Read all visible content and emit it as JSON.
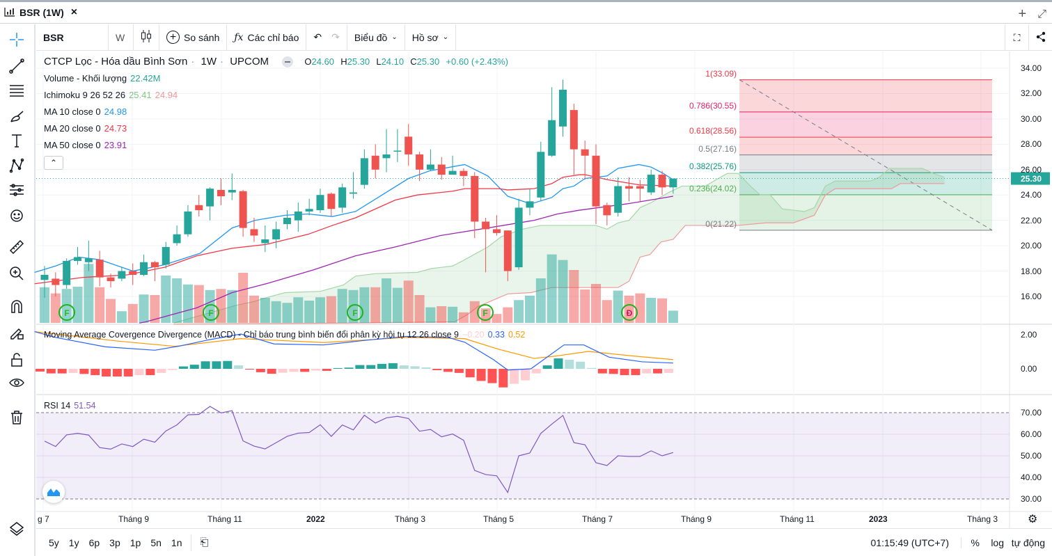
{
  "tab": {
    "title": "BSR (1W)",
    "close": "×",
    "add": "+",
    "maximize": "⤢"
  },
  "toolbar": {
    "symbol": "BSR",
    "interval": "W",
    "compare": "So sánh",
    "indicators": "Các chỉ báo",
    "chart": "Biểu đồ",
    "profile": "Hồ sơ"
  },
  "legend": {
    "name": "CTCP Lọc - Hóa dầu Bình Sơn",
    "interval": "1W",
    "exchange": "UPCOM",
    "o_label": "O",
    "o": "24.60",
    "h_label": "H",
    "h": "25.30",
    "l_label": "L",
    "l": "24.10",
    "c_label": "C",
    "c": "25.30",
    "change": "+0.60 (+2.43%)",
    "volume_label": "Volume - Khối lượng",
    "volume": "22.42M",
    "ichimoku_label": "Ichimoku 9 26 52 26",
    "ichimoku_a": "25.41",
    "ichimoku_b": "24.94",
    "ma10_label": "MA 10 close 0",
    "ma10": "24.98",
    "ma20_label": "MA 20 close 0",
    "ma20": "24.73",
    "ma50_label": "MA 50 close 0",
    "ma50": "23.91"
  },
  "macd_legend": {
    "label": "Moving Average Covergence Divergence (MACD) - Chỉ báo trung bình biến đổi phân kỳ hội tụ 12 26 close 9",
    "hist": "−0.20",
    "macd": "0.33",
    "signal": "0.52"
  },
  "rsi_legend": {
    "label": "RSI 14",
    "value": "51.54"
  },
  "colors": {
    "up": "#26a69a",
    "down": "#ef5350",
    "ma10": "#2196f3",
    "ma20": "#f23645",
    "ma50": "#9c27b0",
    "rsi": "#7e57c2",
    "macd": "#2962ff",
    "signal": "#ff9800"
  },
  "price_axis": [
    "34.00",
    "32.00",
    "30.00",
    "28.00",
    "26.00",
    "24.00",
    "22.00",
    "20.00",
    "18.00",
    "16.00"
  ],
  "current_price": "25.30",
  "macd_axis": [
    "2.00",
    "0.00"
  ],
  "rsi_axis": [
    "70.00",
    "60.00",
    "50.00",
    "40.00",
    "30.00"
  ],
  "time_axis": [
    "g 7",
    "Tháng 9",
    "Tháng 11",
    "2022",
    "Tháng 3",
    "Tháng 5",
    "Tháng 7",
    "Tháng 9",
    "Tháng 11",
    "2023",
    "Tháng 3"
  ],
  "fib": [
    {
      "label": "1(33.09)",
      "price": 33.09,
      "color": "#f23645"
    },
    {
      "label": "0.786(30.55)",
      "price": 30.55,
      "color": "#e91e63"
    },
    {
      "label": "0.618(28.56)",
      "price": 28.56,
      "color": "#f23645"
    },
    {
      "label": "0.5(27.16)",
      "price": 27.16,
      "color": "#787b86"
    },
    {
      "label": "0.382(25.76)",
      "price": 25.76,
      "color": "#089981"
    },
    {
      "label": "0.236(24.02)",
      "price": 24.02,
      "color": "#4caf50"
    },
    {
      "label": "0(21.22)",
      "price": 21.22,
      "color": "#787b86"
    }
  ],
  "signals": [
    "F",
    "F",
    "F",
    "F",
    "Đ"
  ],
  "bottom": {
    "ranges": [
      "5y",
      "1y",
      "6p",
      "3p",
      "1p",
      "5n",
      "1n"
    ],
    "time": "01:15:49 (UTC+7)",
    "percent": "%",
    "log": "log",
    "auto": "tự động"
  },
  "chart_data": {
    "type": "candlestick",
    "candles": [
      [
        17.3,
        18.4,
        15.9,
        17.7
      ],
      [
        17.4,
        17.9,
        16.0,
        16.9
      ],
      [
        16.9,
        19.0,
        16.6,
        18.8
      ],
      [
        18.8,
        19.9,
        18.5,
        19.1
      ],
      [
        18.7,
        20.4,
        18.0,
        19.0
      ],
      [
        18.9,
        19.6,
        16.8,
        17.5
      ],
      [
        17.5,
        17.8,
        16.7,
        17.2
      ],
      [
        17.4,
        18.3,
        17.2,
        18.0
      ],
      [
        18.0,
        18.6,
        16.9,
        17.7
      ],
      [
        17.7,
        19.3,
        17.6,
        18.7
      ],
      [
        18.7,
        18.8,
        17.2,
        18.3
      ],
      [
        18.5,
        20.3,
        18.2,
        19.9
      ],
      [
        20.2,
        21.6,
        20.0,
        20.9
      ],
      [
        20.9,
        23.2,
        20.7,
        22.7
      ],
      [
        23.2,
        24.0,
        22.3,
        22.8
      ],
      [
        23.1,
        24.6,
        22.0,
        24.5
      ],
      [
        24.4,
        25.3,
        23.2,
        23.9
      ],
      [
        24.2,
        25.7,
        23.6,
        24.4
      ],
      [
        24.3,
        24.4,
        20.7,
        21.4
      ],
      [
        21.3,
        22.2,
        20.3,
        20.8
      ],
      [
        20.2,
        21.6,
        19.5,
        20.5
      ],
      [
        20.5,
        21.9,
        19.8,
        21.3
      ],
      [
        21.7,
        22.8,
        21.3,
        22.2
      ],
      [
        22.0,
        23.4,
        21.1,
        22.7
      ],
      [
        22.7,
        23.7,
        22.4,
        22.9
      ],
      [
        22.8,
        24.5,
        22.6,
        24.0
      ],
      [
        24.1,
        24.2,
        22.3,
        22.9
      ],
      [
        23.0,
        24.9,
        22.6,
        24.6
      ],
      [
        24.1,
        25.8,
        23.7,
        24.2
      ],
      [
        24.8,
        27.6,
        24.5,
        26.9
      ],
      [
        27.1,
        28.0,
        25.3,
        26.0
      ],
      [
        26.9,
        29.2,
        25.8,
        27.2
      ],
      [
        27.5,
        29.2,
        26.6,
        27.5
      ],
      [
        28.6,
        29.6,
        26.3,
        27.2
      ],
      [
        27.2,
        27.4,
        25.1,
        26.0
      ],
      [
        26.0,
        27.6,
        25.9,
        26.4
      ],
      [
        26.4,
        27.0,
        25.2,
        25.6
      ],
      [
        25.6,
        27.1,
        25.6,
        25.9
      ],
      [
        25.9,
        26.1,
        24.7,
        25.5
      ],
      [
        25.5,
        25.8,
        20.6,
        21.9
      ],
      [
        21.9,
        22.2,
        17.9,
        21.3
      ],
      [
        21.3,
        22.4,
        20.8,
        21.0
      ],
      [
        21.2,
        21.2,
        17.2,
        18.0
      ],
      [
        18.3,
        23.7,
        18.1,
        23.0
      ],
      [
        23.0,
        24.5,
        22.4,
        23.5
      ],
      [
        23.8,
        28.2,
        23.5,
        27.4
      ],
      [
        27.1,
        32.5,
        27.0,
        29.9
      ],
      [
        29.4,
        33.1,
        28.6,
        32.3
      ],
      [
        30.7,
        31.2,
        25.6,
        27.6
      ],
      [
        27.6,
        28.3,
        25.2,
        27.1
      ],
      [
        27.1,
        28.0,
        21.7,
        23.1
      ],
      [
        23.2,
        23.4,
        21.6,
        22.4
      ],
      [
        22.6,
        25.4,
        22.3,
        24.7
      ],
      [
        24.7,
        25.4,
        23.5,
        24.5
      ],
      [
        24.7,
        25.2,
        23.5,
        24.5
      ],
      [
        24.2,
        26.0,
        24.0,
        25.6
      ],
      [
        25.6,
        25.9,
        24.0,
        24.6
      ],
      [
        24.6,
        25.3,
        24.1,
        25.3
      ]
    ],
    "volume_m": [
      64,
      53,
      61,
      65,
      106,
      64,
      43,
      21,
      34,
      51,
      50,
      85,
      80,
      69,
      68,
      59,
      61,
      59,
      90,
      49,
      45,
      39,
      36,
      46,
      40,
      46,
      48,
      61,
      59,
      64,
      64,
      80,
      63,
      76,
      50,
      28,
      30,
      29,
      19,
      39,
      26,
      16,
      28,
      41,
      49,
      80,
      123,
      113,
      95,
      60,
      70,
      41,
      58,
      49,
      53,
      45,
      44,
      22
    ],
    "ma10": [
      [
        -0.9,
        17.9
      ],
      [
        1,
        18.4
      ],
      [
        3.1,
        19.1
      ],
      [
        5,
        18.9
      ],
      [
        8,
        18.0
      ],
      [
        10.9,
        18.5
      ],
      [
        14.1,
        19.4
      ],
      [
        17,
        21.4
      ],
      [
        19.1,
        22.0
      ],
      [
        21.8,
        22.4
      ],
      [
        23.9,
        22.5
      ],
      [
        26.1,
        22.3
      ],
      [
        28.2,
        22.7
      ],
      [
        33,
        25.3
      ],
      [
        34.9,
        25.9
      ],
      [
        38.1,
        26.4
      ],
      [
        40.2,
        25.5
      ],
      [
        42,
        23.9
      ],
      [
        44.1,
        23.3
      ],
      [
        46,
        23.8
      ],
      [
        47,
        24.5
      ],
      [
        48,
        24.7
      ],
      [
        49,
        25.3
      ],
      [
        51,
        25.5
      ],
      [
        52,
        26.1
      ],
      [
        53.9,
        26.4
      ],
      [
        55,
        26.2
      ],
      [
        56.1,
        25.7
      ],
      [
        57,
        25.2
      ]
    ],
    "ma20": [
      [
        -0.9,
        17.0
      ],
      [
        3.5,
        17.5
      ],
      [
        7.5,
        17.7
      ],
      [
        10.9,
        18.3
      ],
      [
        13.8,
        19.2
      ],
      [
        17,
        19.8
      ],
      [
        20.1,
        20.1
      ],
      [
        23.9,
        20.9
      ],
      [
        26.1,
        21.6
      ],
      [
        28.2,
        22.2
      ],
      [
        31.8,
        23.6
      ],
      [
        33.8,
        24.0
      ],
      [
        37,
        24.3
      ],
      [
        38.1,
        24.5
      ],
      [
        41.2,
        24.5
      ],
      [
        42,
        24.4
      ],
      [
        44.4,
        24.5
      ],
      [
        46,
        24.9
      ],
      [
        47,
        25.4
      ],
      [
        48.5,
        25.6
      ],
      [
        49,
        25.6
      ],
      [
        51.1,
        25.2
      ],
      [
        53.9,
        24.8
      ],
      [
        57,
        24.7
      ]
    ],
    "ma50": [
      [
        8.6,
        13.9
      ],
      [
        9.2,
        14.0
      ],
      [
        13.8,
        15.1
      ],
      [
        17,
        16.3
      ],
      [
        20.1,
        17.0
      ],
      [
        24.4,
        18.1
      ],
      [
        28.2,
        19.2
      ],
      [
        31.8,
        19.9
      ],
      [
        35.9,
        20.8
      ],
      [
        40.2,
        21.4
      ],
      [
        44.4,
        22.0
      ],
      [
        46.5,
        22.5
      ],
      [
        48.5,
        22.8
      ],
      [
        52.8,
        23.3
      ],
      [
        57,
        23.9
      ]
    ],
    "ichimoku_span_a": [
      [
        11.7,
        13.9
      ],
      [
        17.4,
        15.3
      ],
      [
        19,
        15.6
      ],
      [
        20.1,
        15.9
      ],
      [
        21.8,
        16.3
      ],
      [
        25,
        16.4
      ],
      [
        27.1,
        16.9
      ],
      [
        28.2,
        17.6
      ],
      [
        30,
        17.8
      ],
      [
        33.8,
        17.9
      ],
      [
        35.1,
        18.2
      ],
      [
        37,
        18.4
      ],
      [
        37.9,
        18.8
      ],
      [
        40.2,
        19.9
      ],
      [
        41.4,
        20.7
      ],
      [
        43.3,
        21.3
      ],
      [
        45,
        21.6
      ],
      [
        50,
        21.6
      ],
      [
        51,
        21.3
      ],
      [
        52,
        21.8
      ],
      [
        53,
        22.0
      ],
      [
        54,
        23.0
      ],
      [
        55,
        23.4
      ],
      [
        56.6,
        24.2
      ],
      [
        57.8,
        24.7
      ],
      [
        59.9,
        24.7
      ],
      [
        61.9,
        25.7
      ],
      [
        62.9,
        25.7
      ],
      [
        64,
        24.7
      ],
      [
        64.9,
        24.0
      ],
      [
        65.8,
        24.0
      ],
      [
        66.9,
        22.9
      ],
      [
        68.9,
        22.7
      ],
      [
        69.8,
        23.0
      ],
      [
        70.8,
        24.7
      ],
      [
        71.7,
        25.1
      ],
      [
        74.9,
        25.1
      ],
      [
        75.7,
        25.4
      ],
      [
        76.6,
        26.1
      ],
      [
        79.6,
        26.1
      ],
      [
        80.6,
        25.7
      ],
      [
        81.6,
        25.4
      ]
    ],
    "ichimoku_span_b": [
      [
        11.7,
        13.8
      ],
      [
        27.5,
        13.9
      ],
      [
        37.2,
        14.0
      ],
      [
        38.4,
        14.6
      ],
      [
        39.3,
        15.2
      ],
      [
        42,
        16.2
      ],
      [
        44.1,
        16.3
      ],
      [
        46,
        16.7
      ],
      [
        52,
        16.7
      ],
      [
        53,
        17.2
      ],
      [
        54,
        19.1
      ],
      [
        54.9,
        19.3
      ],
      [
        55.9,
        20.3
      ],
      [
        57,
        20.5
      ],
      [
        58.1,
        21.6
      ],
      [
        62.9,
        21.6
      ],
      [
        65.4,
        21.8
      ],
      [
        67.9,
        21.8
      ],
      [
        69.8,
        22.4
      ],
      [
        70.8,
        24.0
      ],
      [
        71.7,
        24.5
      ],
      [
        76.8,
        24.5
      ],
      [
        77.6,
        24.9
      ],
      [
        81.6,
        24.9
      ]
    ],
    "macd_hist": [
      -0.16,
      -0.27,
      -0.27,
      -0.24,
      -0.3,
      -0.37,
      -0.45,
      -0.45,
      -0.45,
      -0.37,
      -0.37,
      -0.24,
      -0.07,
      0.14,
      0.24,
      0.44,
      0.44,
      0.46,
      0.2,
      -0.04,
      -0.2,
      -0.29,
      -0.23,
      -0.18,
      -0.18,
      -0.1,
      -0.12,
      0.04,
      0.07,
      0.22,
      0.22,
      0.29,
      0.33,
      0.2,
      0.15,
      0.08,
      -0.08,
      -0.18,
      -0.24,
      -0.5,
      -0.71,
      -0.84,
      -1.09,
      -0.88,
      -0.68,
      -0.27,
      0.2,
      0.61,
      0.53,
      0.42,
      0.05,
      -0.27,
      -0.3,
      -0.37,
      -0.37,
      -0.27,
      -0.27,
      -0.24
    ],
    "macd_line": [
      [
        -0.9,
        2.18
      ],
      [
        1,
        1.84
      ],
      [
        5.5,
        1.29
      ],
      [
        10,
        1.09
      ],
      [
        12.2,
        1.33
      ],
      [
        14.9,
        1.7
      ],
      [
        17.8,
        2.04
      ],
      [
        20.8,
        1.46
      ],
      [
        25.3,
        1.4
      ],
      [
        29.1,
        1.67
      ],
      [
        32.8,
        1.9
      ],
      [
        36.6,
        1.84
      ],
      [
        38.1,
        1.56
      ],
      [
        40.7,
        0.54
      ],
      [
        42,
        -0.07
      ],
      [
        44.1,
        0.0
      ],
      [
        47.1,
        1.4
      ],
      [
        48.9,
        1.4
      ],
      [
        51.2,
        0.68
      ],
      [
        54.2,
        0.41
      ],
      [
        57,
        0.34
      ]
    ],
    "signal_line": [
      [
        -0.9,
        2.18
      ],
      [
        6.6,
        1.63
      ],
      [
        11.8,
        1.32
      ],
      [
        17.8,
        1.77
      ],
      [
        25.3,
        1.54
      ],
      [
        32.8,
        1.84
      ],
      [
        38.1,
        1.77
      ],
      [
        41.1,
        1.16
      ],
      [
        44.4,
        0.61
      ],
      [
        46.4,
        0.75
      ],
      [
        49.3,
        1.02
      ],
      [
        53.4,
        0.75
      ],
      [
        57,
        0.54
      ]
    ],
    "rsi": [
      56.8,
      54.3,
      59.7,
      60.4,
      59.6,
      53.8,
      53.1,
      55.5,
      54.3,
      57.7,
      56.3,
      61.5,
      64.3,
      69.0,
      69.2,
      72.9,
      69.9,
      70.9,
      56.9,
      54.5,
      53.2,
      56.1,
      59.0,
      60.5,
      60.8,
      64.4,
      59.0,
      64.3,
      62.0,
      68.8,
      65.2,
      67.6,
      68.3,
      67.3,
      61.4,
      62.2,
      58.8,
      60.1,
      57.2,
      43.2,
      41.3,
      40.7,
      33.0,
      50.0,
      51.3,
      60.4,
      64.7,
      68.7,
      56.1,
      55.1,
      46.8,
      45.5,
      50.0,
      49.7,
      49.7,
      52.3,
      50.0,
      51.5
    ],
    "ylim": [
      15,
      34.5
    ],
    "macd_ylim": [
      -1.2,
      2.2
    ],
    "rsi_ylim": [
      30,
      70
    ]
  }
}
